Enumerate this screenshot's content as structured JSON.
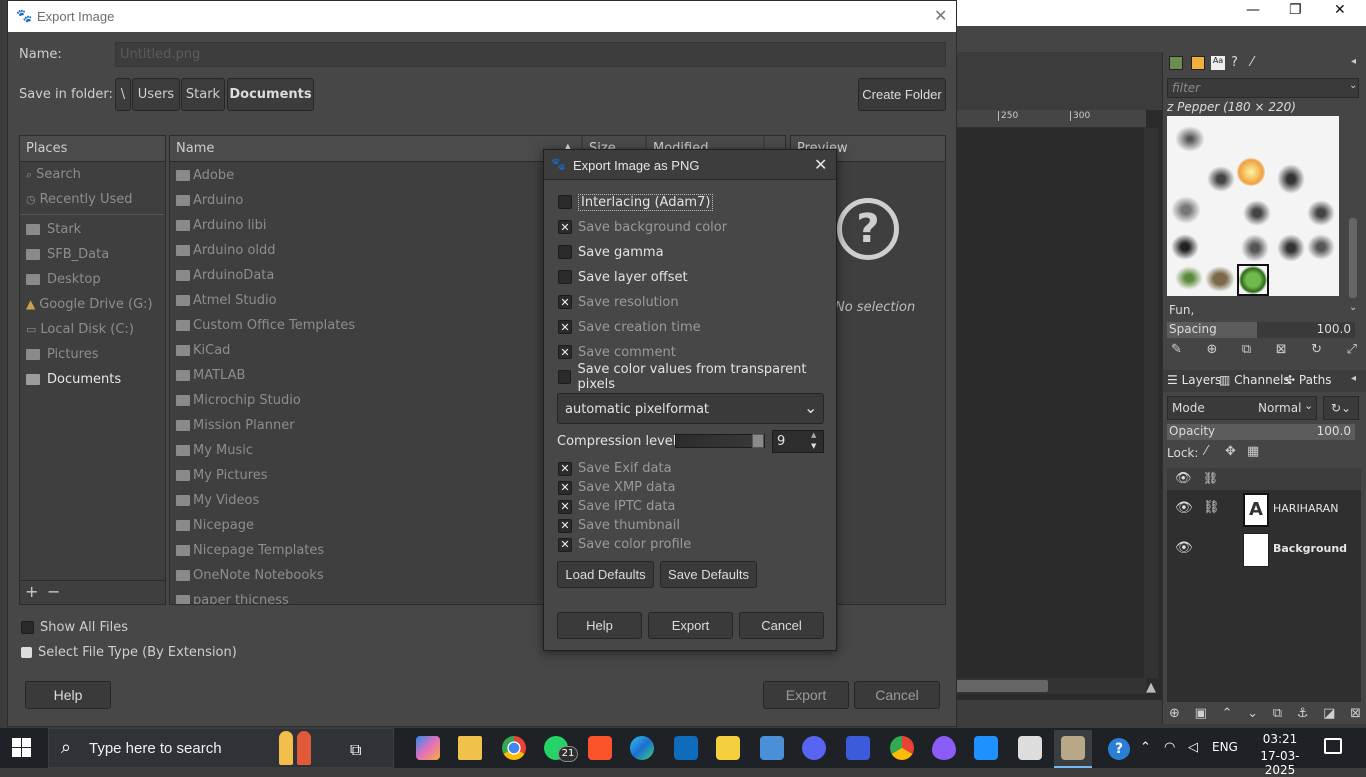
{
  "gimp": {
    "ruler_ticks": [
      "250",
      "300"
    ],
    "brushes": {
      "filter_placeholder": "filter",
      "brush_name": "z Pepper (180 × 220)",
      "preset": "Fun,",
      "spacing_label": "Spacing",
      "spacing_value": "100.0"
    },
    "layers": {
      "tabs": [
        "Layers",
        "Channels",
        "Paths"
      ],
      "mode_label": "Mode",
      "mode_value": "Normal",
      "opacity_label": "Opacity",
      "opacity_value": "100.0",
      "lock_label": "Lock:",
      "items": [
        {
          "name": "HARIHARAN",
          "bold": false
        },
        {
          "name": "Background",
          "bold": true
        }
      ]
    }
  },
  "export_dialog": {
    "title": "Export Image",
    "name_label": "Name:",
    "name_value": "Untitled.png",
    "save_in_label": "Save in folder:",
    "path": [
      "\\",
      "Users",
      "Stark",
      "Documents"
    ],
    "create_folder": "Create Folder",
    "places_header": "Places",
    "places": [
      {
        "label": "Search",
        "active": false
      },
      {
        "label": "Recently Used",
        "active": false
      },
      {
        "label": "Stark",
        "active": false
      },
      {
        "label": "SFB_Data",
        "active": false
      },
      {
        "label": "Desktop",
        "active": false
      },
      {
        "label": "Google Drive (G:)",
        "active": false
      },
      {
        "label": "Local Disk (C:)",
        "active": false
      },
      {
        "label": "Pictures",
        "active": false
      },
      {
        "label": "Documents",
        "active": true
      }
    ],
    "columns": {
      "name": "Name",
      "size": "Size",
      "modified": "Modified"
    },
    "files": [
      "Adobe",
      "Arduino",
      "Arduino libi",
      "Arduino oldd",
      "ArduinoData",
      "Atmel Studio",
      "Custom Office Templates",
      "KiCad",
      "MATLAB",
      "Microchip Studio",
      "Mission Planner",
      "My Music",
      "My Pictures",
      "My Videos",
      "Nicepage",
      "Nicepage Templates",
      "OneNote Notebooks",
      "paper thicness"
    ],
    "preview_header": "Preview",
    "no_selection": "No selection",
    "show_all_files": "Show All Files",
    "file_type": "Select File Type (By Extension)",
    "help": "Help",
    "export": "Export",
    "cancel": "Cancel"
  },
  "png_dialog": {
    "title": "Export Image as PNG",
    "options": [
      {
        "label": "Interlacing (Adam7)",
        "checked": false
      },
      {
        "label": "Save background color",
        "checked": true
      },
      {
        "label": "Save gamma",
        "checked": false
      },
      {
        "label": "Save layer offset",
        "checked": false
      },
      {
        "label": "Save resolution",
        "checked": true
      },
      {
        "label": "Save creation time",
        "checked": true
      },
      {
        "label": "Save comment",
        "checked": true
      },
      {
        "label": "Save color values from transparent pixels",
        "checked": false
      }
    ],
    "pixelformat": "automatic pixelformat",
    "compression_label": "Compression level:",
    "compression_value": "9",
    "compression_fraction": 1.0,
    "metadata": [
      {
        "label": "Save Exif data",
        "checked": true
      },
      {
        "label": "Save XMP data",
        "checked": true
      },
      {
        "label": "Save IPTC data",
        "checked": true
      },
      {
        "label": "Save thumbnail",
        "checked": true
      },
      {
        "label": "Save color profile",
        "checked": true
      }
    ],
    "load_defaults": "Load Defaults",
    "save_defaults": "Save Defaults",
    "help": "Help",
    "export": "Export",
    "cancel": "Cancel"
  },
  "taskbar": {
    "search_placeholder": "Type here to search",
    "whatsapp_badge": "21",
    "language": "ENG",
    "time": "03:21",
    "date": "17-03-2025"
  }
}
